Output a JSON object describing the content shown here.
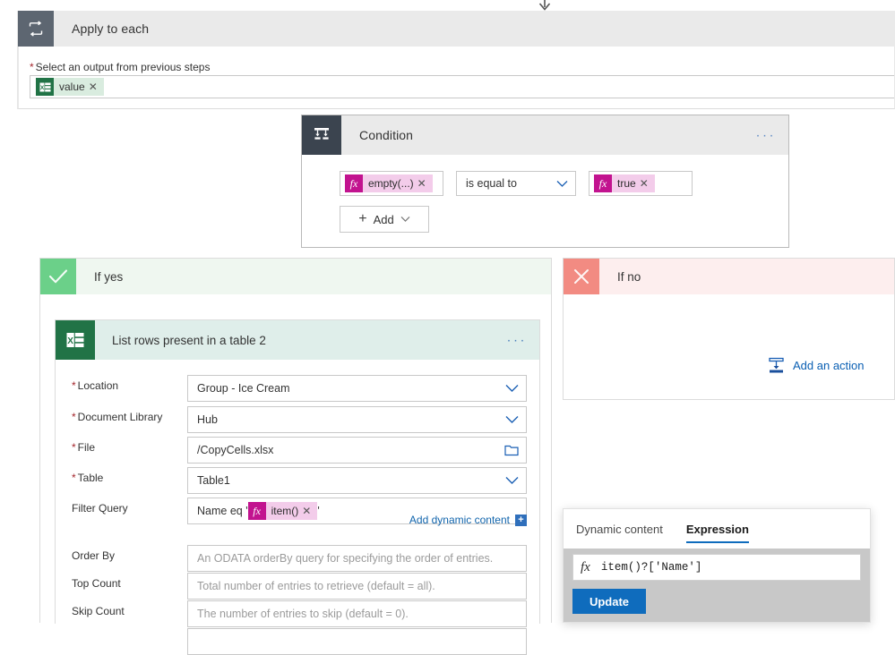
{
  "loop": {
    "title": "Apply to each",
    "icon": "loop-icon",
    "field_label": "Select an output from previous steps",
    "required": true,
    "token": {
      "text": "value",
      "icon": "excel-icon",
      "remove": "✕"
    }
  },
  "condition": {
    "title": "Condition",
    "icon": "condition-branch-icon",
    "more_menu": "···",
    "left_operand": {
      "text": "empty(...)",
      "icon": "fx-icon",
      "remove": "✕"
    },
    "operator": {
      "value": "is equal to",
      "chevron": "chevron-down-icon"
    },
    "right_operand": {
      "text": "true",
      "icon": "fx-icon",
      "remove": "✕"
    },
    "add_button": {
      "label": "Add",
      "plus": "+",
      "chevron": "chevron-down-icon"
    }
  },
  "branches": {
    "yes": {
      "label": "If yes",
      "mark": "check-icon"
    },
    "no": {
      "label": "If no",
      "mark": "close-icon",
      "add_action": "Add an action"
    }
  },
  "action": {
    "title": "List rows present in a table 2",
    "icon": "excel-icon",
    "more_menu": "···",
    "fields": [
      {
        "label": "Location",
        "required": true,
        "value": "Group - Ice Cream",
        "placeholder": "",
        "control": "dropdown"
      },
      {
        "label": "Document Library",
        "required": true,
        "value": "Hub",
        "placeholder": "",
        "control": "dropdown"
      },
      {
        "label": "File",
        "required": true,
        "value": "/CopyCells.xlsx",
        "placeholder": "",
        "control": "file-picker"
      },
      {
        "label": "Table",
        "required": true,
        "value": "Table1",
        "placeholder": "",
        "control": "dropdown"
      },
      {
        "label": "Filter Query",
        "required": false,
        "value": "",
        "placeholder": "",
        "control": "token-text"
      },
      {
        "label": "Order By",
        "required": false,
        "value": "",
        "placeholder": "An ODATA orderBy query for specifying the order of entries.",
        "control": "text"
      },
      {
        "label": "Top Count",
        "required": false,
        "value": "",
        "placeholder": "Total number of entries to retrieve (default = all).",
        "control": "text"
      },
      {
        "label": "Skip Count",
        "required": false,
        "value": "",
        "placeholder": "The number of entries to skip (default = 0).",
        "control": "text"
      }
    ],
    "filter_query": {
      "prefix": "Name eq '",
      "token": {
        "text": "item()",
        "icon": "fx-icon",
        "remove": "✕"
      },
      "suffix": "'"
    },
    "add_dynamic_content": {
      "label": "Add dynamic content",
      "badge": "+"
    }
  },
  "flyout": {
    "tabs": [
      {
        "label": "Dynamic content",
        "active": false
      },
      {
        "label": "Expression",
        "active": true
      }
    ],
    "expression": {
      "fx": "fx",
      "value": "item()?['Name']"
    },
    "update_button": "Update"
  },
  "colors": {
    "accent_blue": "#0f6cbd",
    "excel_green": "#217346",
    "fx_magenta": "#c2138f",
    "yes_green": "#6bd089",
    "no_red": "#f28b82",
    "header_gray": "#eaeaea",
    "icon_slate": "#3b444f"
  }
}
